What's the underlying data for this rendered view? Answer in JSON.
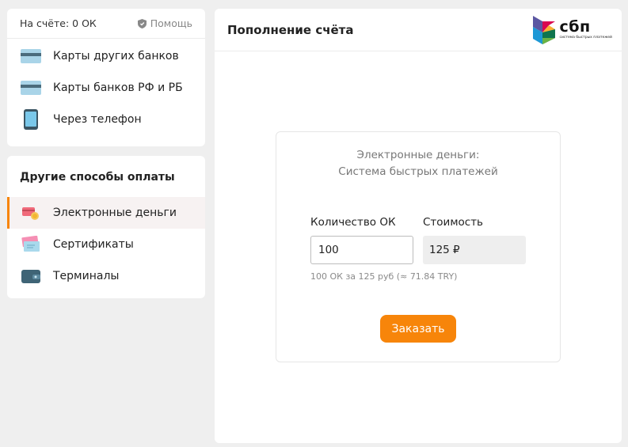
{
  "balance": {
    "label": "На счёте: 0 ОК"
  },
  "help": {
    "label": "Помощь"
  },
  "top_methods": [
    {
      "label": "Карты других банков",
      "icon": "card-icon"
    },
    {
      "label": "Карты банков РФ и РБ",
      "icon": "card-icon"
    },
    {
      "label": "Через телефон",
      "icon": "phone-icon"
    }
  ],
  "other_methods": {
    "title": "Другие способы оплаты",
    "items": [
      {
        "label": "Электронные деньги",
        "icon": "e-money-icon",
        "active": true
      },
      {
        "label": "Сертификаты",
        "icon": "certificate-icon"
      },
      {
        "label": "Терминалы",
        "icon": "wallet-icon"
      }
    ]
  },
  "main": {
    "title": "Пополнение счёта",
    "logo": {
      "word": "сбп",
      "subtitle": "система быстрых платежей"
    },
    "payment": {
      "heading_line1": "Электронные деньги:",
      "heading_line2": "Система быстрых платежей",
      "qty_label": "Количество ОК",
      "cost_label": "Стоимость",
      "qty_value": "100",
      "cost_value": "125 ₽",
      "hint": "100 ОК за 125 руб (≈ 71.84 TRY)",
      "order_label": "Заказать"
    }
  },
  "colors": {
    "accent": "#f7850a",
    "background": "#efefef"
  }
}
